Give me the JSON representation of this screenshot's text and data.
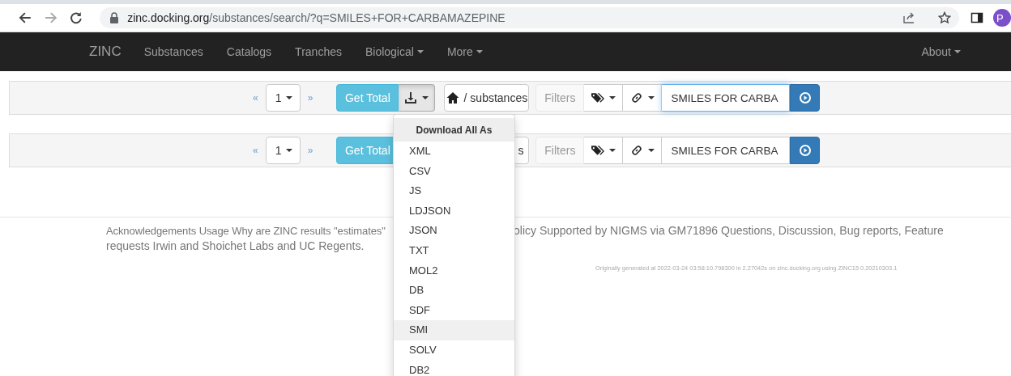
{
  "browser": {
    "url_host": "zinc.docking.org",
    "url_path": "/substances/search/?q=SMILES+FOR+CARBAMAZEPINE",
    "avatar_letter": "P"
  },
  "navbar": {
    "brand": "ZINC",
    "items": [
      {
        "label": "Substances",
        "dropdown": false
      },
      {
        "label": "Catalogs",
        "dropdown": false
      },
      {
        "label": "Tranches",
        "dropdown": false
      },
      {
        "label": "Biological",
        "dropdown": true
      },
      {
        "label": "More",
        "dropdown": true
      }
    ],
    "right_items": [
      {
        "label": "About",
        "dropdown": true
      }
    ]
  },
  "toolbars": [
    {
      "prev": "«",
      "page": "1",
      "next": "»",
      "get_total": "Get Total",
      "download": {
        "active": true
      },
      "breadcrumb": {
        "text": "/ substances",
        "home_icon": true
      },
      "filters": "Filters",
      "search": {
        "value": "SMILES FOR CARBA",
        "focused": true
      }
    },
    {
      "prev": "«",
      "page": "1",
      "next": "»",
      "get_total": "Get Total",
      "breadcrumb": {
        "text": "s",
        "home_icon": false
      },
      "filters": "Filters",
      "search": {
        "value": "SMILES FOR CARBA",
        "focused": false
      }
    }
  ],
  "download_menu": {
    "header": "Download All As",
    "items": [
      {
        "label": "XML",
        "selected": false
      },
      {
        "label": "CSV",
        "selected": false
      },
      {
        "label": "JS",
        "selected": false
      },
      {
        "label": "LDJSON",
        "selected": false
      },
      {
        "label": "JSON",
        "selected": false
      },
      {
        "label": "TXT",
        "selected": false
      },
      {
        "label": "MOL2",
        "selected": false
      },
      {
        "label": "DB",
        "selected": false
      },
      {
        "label": "SDF",
        "selected": false
      },
      {
        "label": "SMI",
        "selected": true
      },
      {
        "label": "SOLV",
        "selected": false
      },
      {
        "label": "DB2",
        "selected": false
      }
    ]
  },
  "footer": {
    "line1_left": "Acknowledgements Usage Why are ZINC results \"estimates\"",
    "line1_right": "olicy Supported by NIGMS via GM71896 Questions, Discussion, Bug reports, Feature",
    "line2": "requests Irwin and Shoichet Labs and UC Regents.",
    "generated": "Originally generated at 2022-03-24 03:58:10.798300 in 2.27042s on zinc.docking.org using ZINC15 0.20210303.1"
  }
}
